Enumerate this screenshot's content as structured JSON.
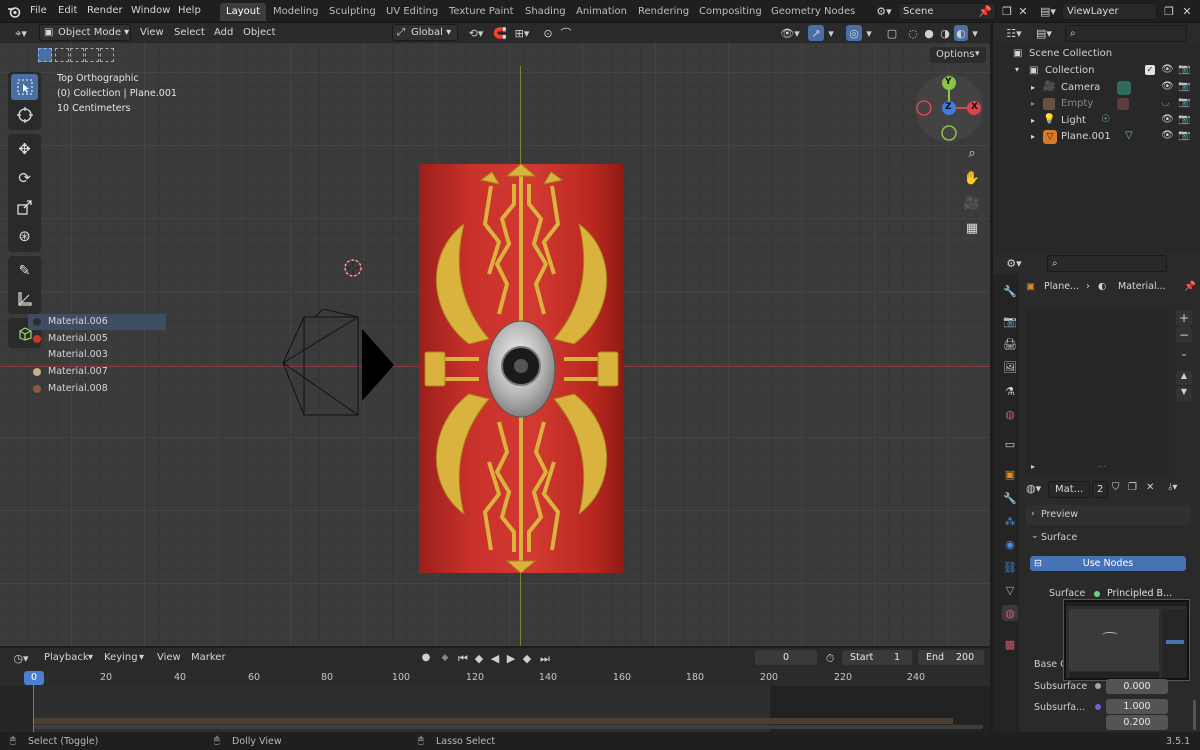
{
  "topbar": {
    "menus": [
      "File",
      "Edit",
      "Render",
      "Window",
      "Help"
    ],
    "workspaces": [
      "Layout",
      "Modeling",
      "Sculpting",
      "UV Editing",
      "Texture Paint",
      "Shading",
      "Animation",
      "Rendering",
      "Compositing",
      "Geometry Nodes"
    ],
    "scene": "Scene",
    "view_layer": "ViewLayer"
  },
  "viewport": {
    "mode": "Object Mode",
    "menus": [
      "View",
      "Select",
      "Add",
      "Object"
    ],
    "transform_orientation": "Global",
    "options_label": "Options",
    "overlay": {
      "view_name": "Top Orthographic",
      "collection": "(0) Collection | Plane.001",
      "scale": "10 Centimeters"
    },
    "gizmo": {
      "y": "Y",
      "x": "X",
      "z": "Z"
    }
  },
  "outliner": {
    "root": "Scene Collection",
    "collection": "Collection",
    "items": [
      "Camera",
      "Empty",
      "Light",
      "Plane.001"
    ]
  },
  "properties": {
    "breadcrumb_object": "Plane...",
    "breadcrumb_material": "Material...",
    "materials": [
      "Material.006",
      "Material.005",
      "Material.003",
      "Material.007",
      "Material.008"
    ],
    "material_colors": [
      "#2d2d2d",
      "#c23a2a",
      "#3a3a3a",
      "#c9b08a",
      "#8a5a3a"
    ],
    "active_material": "Mat...",
    "users": "2",
    "preview_label": "Preview",
    "surface_label": "Surface",
    "use_nodes": "Use Nodes",
    "surface_field_label": "Surface",
    "surface_value": "Principled B...",
    "base_color_label": "Base C",
    "subsurface_label": "Subsurface",
    "subsurface_value": "0.000",
    "subsurface_radius_label": "Subsurfa...",
    "subsurface_radius_1": "1.000",
    "subsurface_radius_2": "0.200"
  },
  "timeline": {
    "menus": [
      "Playback",
      "Keying",
      "View",
      "Marker"
    ],
    "current_frame": "0",
    "start_label": "Start",
    "start": "1",
    "end_label": "End",
    "end": "200",
    "ticks": [
      "0",
      "20",
      "40",
      "60",
      "80",
      "100",
      "120",
      "140",
      "160",
      "180",
      "200",
      "220",
      "240"
    ]
  },
  "statusbar": {
    "select": "Select (Toggle)",
    "dolly": "Dolly View",
    "lasso": "Lasso Select",
    "version": "3.5.1"
  }
}
